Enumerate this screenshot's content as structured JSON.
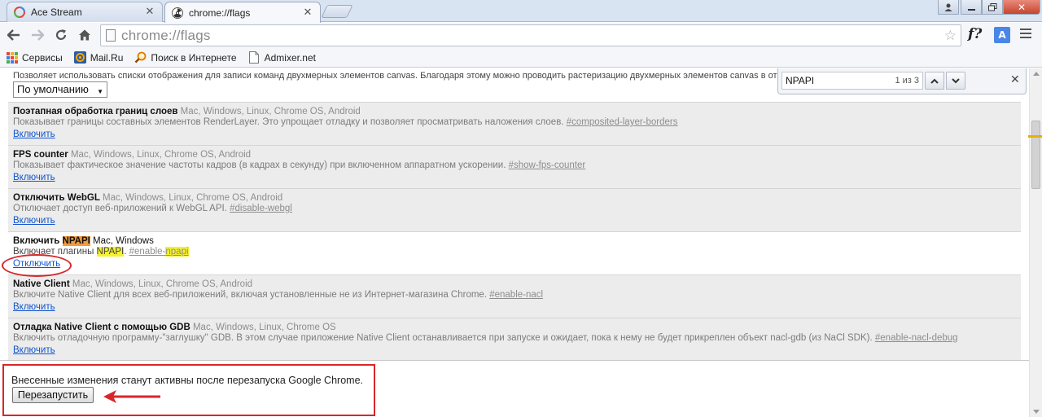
{
  "tabs": [
    {
      "title": "Ace Stream",
      "icon": "ace-stream-icon",
      "active": false
    },
    {
      "title": "chrome://flags",
      "icon": "flags-radiation-icon",
      "active": true
    }
  ],
  "toolbar": {
    "url": "chrome://flags"
  },
  "bookmarks": [
    {
      "label": "Сервисы",
      "icon": "apps-grid-icon"
    },
    {
      "label": "Mail.Ru",
      "icon": "mailru-icon"
    },
    {
      "label": "Поиск в Интернете",
      "icon": "search-magnifier-icon"
    },
    {
      "label": "Admixer.net",
      "icon": "page-icon"
    }
  ],
  "top_partial": {
    "description": "Позволяет использовать списки отображения для записи команд двухмерных элементов canvas. Благодаря этому можно проводить растеризацию двухмерных элементов canvas в от",
    "select_value": "По умолчанию"
  },
  "findbar": {
    "query": "NPAPI",
    "count": "1 из 3"
  },
  "experiments": [
    {
      "name": "Поэтапная обработка границ слоев",
      "platforms": "Mac, Windows, Linux, Chrome OS, Android",
      "description": "Показывает границы составных элементов RenderLayer. Это упрощает отладку и позволяет просматривать наложения слоев.",
      "anchor": "#composited-layer-borders",
      "action": "Включить"
    },
    {
      "name": "FPS counter",
      "platforms": "Mac, Windows, Linux, Chrome OS, Android",
      "description": "Показывает фактическое значение частоты кадров (в кадрах в секунду) при включенном аппаратном ускорении.",
      "anchor": "#show-fps-counter",
      "action": "Включить"
    },
    {
      "name": "Отключить WebGL",
      "platforms": "Mac, Windows, Linux, Chrome OS, Android",
      "description": "Отключает доступ веб-приложений к WebGL API.",
      "anchor": "#disable-webgl",
      "action": "Включить"
    },
    {
      "name_prefix": "Включить ",
      "name_highlight": "NPAPI",
      "platforms": "Mac, Windows",
      "description_prefix": "Включает плагины ",
      "description_highlight": "NPAPI",
      "description_suffix": ".",
      "anchor_prefix": "#enable-",
      "anchor_highlight": "npapi",
      "action": "Отключить"
    },
    {
      "name": "Native Client",
      "platforms": "Mac, Windows, Linux, Chrome OS, Android",
      "description": "Включите Native Client для всех веб-приложений, включая установленные не из Интернет-магазина Chrome.",
      "anchor": "#enable-nacl",
      "action": "Включить"
    },
    {
      "name": "Отладка Native Client с помощью GDB",
      "platforms": "Mac, Windows, Linux, Chrome OS",
      "description": "Включить отладочную программу-\"заглушку\" GDB. В этом случае приложение Native Client останавливается при запуске и ожидает, пока к нему не будет прикреплен объект nacl-gdb (из NaCl SDK).",
      "anchor": "#enable-nacl-debug",
      "action": "Включить"
    }
  ],
  "restart": {
    "message": "Внесенные изменения станут активны после перезапуска Google Chrome.",
    "button": "Перезапустить"
  },
  "colors": {
    "link": "#1155cc",
    "highlight_current": "#f29a3c",
    "highlight_other": "#f5f22c",
    "annotation_red": "#d9262a"
  }
}
